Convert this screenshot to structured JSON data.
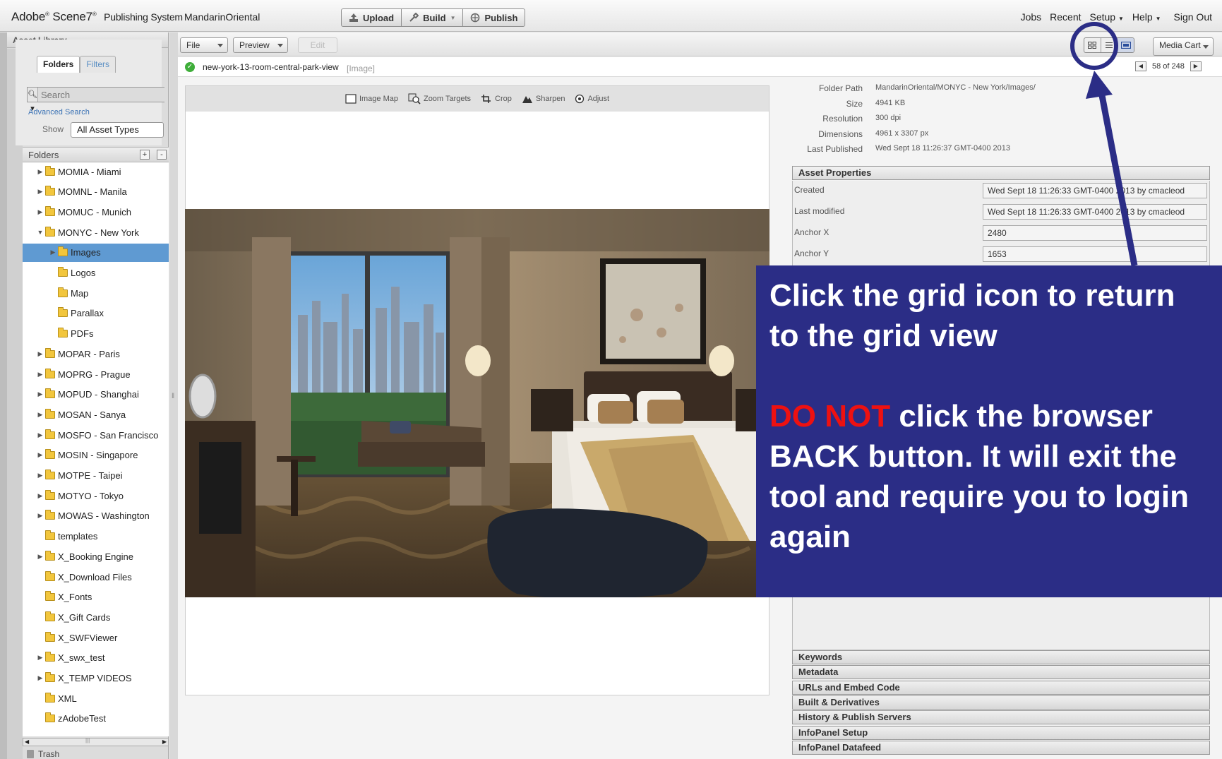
{
  "header": {
    "brand": "Adobe",
    "brand_product": "Scene7",
    "brand_sub": "Publishing System",
    "company": "MandarinOriental",
    "buttons": [
      {
        "label": "Upload",
        "icon": "upload-icon"
      },
      {
        "label": "Build",
        "icon": "build-icon"
      },
      {
        "label": "Publish",
        "icon": "publish-icon"
      }
    ],
    "nav": [
      "Jobs",
      "Recent",
      "Setup",
      "Help",
      "Sign Out"
    ]
  },
  "left_panel": {
    "title": "Asset Library",
    "tabs": [
      "Folders",
      "Filters"
    ],
    "search_placeholder": "Search",
    "advanced_search": "Advanced Search",
    "show_label": "Show",
    "asset_type": "All Asset Types",
    "folders_title": "Folders",
    "folders": [
      {
        "name": "MOMIA - Miami",
        "level": 0,
        "expand": "collapsed"
      },
      {
        "name": "MOMNL - Manila",
        "level": 0,
        "expand": "collapsed"
      },
      {
        "name": "MOMUC - Munich",
        "level": 0,
        "expand": "collapsed"
      },
      {
        "name": "MONYC - New York",
        "level": 0,
        "expand": "expanded"
      },
      {
        "name": "Images",
        "level": 1,
        "expand": "collapsed",
        "selected": true
      },
      {
        "name": "Logos",
        "level": 1,
        "expand": "none"
      },
      {
        "name": "Map",
        "level": 1,
        "expand": "none"
      },
      {
        "name": "Parallax",
        "level": 1,
        "expand": "none"
      },
      {
        "name": "PDFs",
        "level": 1,
        "expand": "none"
      },
      {
        "name": "MOPAR - Paris",
        "level": 0,
        "expand": "collapsed"
      },
      {
        "name": "MOPRG - Prague",
        "level": 0,
        "expand": "collapsed"
      },
      {
        "name": "MOPUD - Shanghai",
        "level": 0,
        "expand": "collapsed"
      },
      {
        "name": "MOSAN - Sanya",
        "level": 0,
        "expand": "collapsed"
      },
      {
        "name": "MOSFO - San Francisco",
        "level": 0,
        "expand": "collapsed"
      },
      {
        "name": "MOSIN - Singapore",
        "level": 0,
        "expand": "collapsed"
      },
      {
        "name": "MOTPE - Taipei",
        "level": 0,
        "expand": "collapsed"
      },
      {
        "name": "MOTYO - Tokyo",
        "level": 0,
        "expand": "collapsed"
      },
      {
        "name": "MOWAS - Washington",
        "level": 0,
        "expand": "collapsed"
      },
      {
        "name": "templates",
        "level": 0,
        "expand": "none"
      },
      {
        "name": "X_Booking Engine",
        "level": 0,
        "expand": "collapsed"
      },
      {
        "name": "X_Download Files",
        "level": 0,
        "expand": "none"
      },
      {
        "name": "X_Fonts",
        "level": 0,
        "expand": "none"
      },
      {
        "name": "X_Gift Cards",
        "level": 0,
        "expand": "none"
      },
      {
        "name": "X_SWFViewer",
        "level": 0,
        "expand": "none"
      },
      {
        "name": "X_swx_test",
        "level": 0,
        "expand": "collapsed"
      },
      {
        "name": "X_TEMP VIDEOS",
        "level": 0,
        "expand": "collapsed"
      },
      {
        "name": "XML",
        "level": 0,
        "expand": "none"
      },
      {
        "name": "zAdobeTest",
        "level": 0,
        "expand": "none"
      }
    ],
    "trash": "Trash"
  },
  "toolbar": {
    "file": "File",
    "preview": "Preview",
    "edit": "Edit",
    "media_cart": "Media Cart"
  },
  "asset": {
    "name": "new-york-13-room-central-park-view",
    "type": "[Image]",
    "pager": "58 of 248"
  },
  "preview_tools": [
    {
      "label": "Image Map",
      "icon": "image-map-icon"
    },
    {
      "label": "Zoom Targets",
      "icon": "zoom-targets-icon"
    },
    {
      "label": "Crop",
      "icon": "crop-icon"
    },
    {
      "label": "Sharpen",
      "icon": "sharpen-icon"
    },
    {
      "label": "Adjust",
      "icon": "adjust-icon"
    }
  ],
  "info": [
    {
      "label": "Folder Path",
      "value": "MandarinOriental/MONYC - New York/Images/"
    },
    {
      "label": "Size",
      "value": "4941 KB"
    },
    {
      "label": "Resolution",
      "value": "300 dpi"
    },
    {
      "label": "Dimensions",
      "value": "4961 x 3307 px"
    },
    {
      "label": "Last Published",
      "value": "Wed  Sept 18 11:26:37 GMT-0400 2013"
    }
  ],
  "asset_properties": {
    "title": "Asset Properties",
    "rows": [
      {
        "label": "Created",
        "value": "Wed  Sept 18 11:26:33 GMT-0400 2013 by cmacleod"
      },
      {
        "label": "Last modified",
        "value": "Wed  Sept 18 11:26:33 GMT-0400 2013 by cmacleod"
      },
      {
        "label": "Anchor X",
        "value": "2480"
      },
      {
        "label": "Anchor Y",
        "value": "1653"
      }
    ]
  },
  "accordions": [
    "Keywords",
    "Metadata",
    "URLs and Embed Code",
    "Built & Derivatives",
    "History & Publish Servers",
    "InfoPanel Setup",
    "InfoPanel Datafeed"
  ],
  "callout": {
    "line1": "Click the grid icon to return",
    "line2": "to the grid view",
    "warn": "DO NOT",
    "line3": " click the browser",
    "line4": "BACK button. It will exit the",
    "line5": "tool and require you to login",
    "line6": "again"
  },
  "colors": {
    "callout_bg": "#2b2d86",
    "warn": "#ee1111",
    "selection": "#5f9ad2",
    "annotation": "#2b2d86"
  }
}
